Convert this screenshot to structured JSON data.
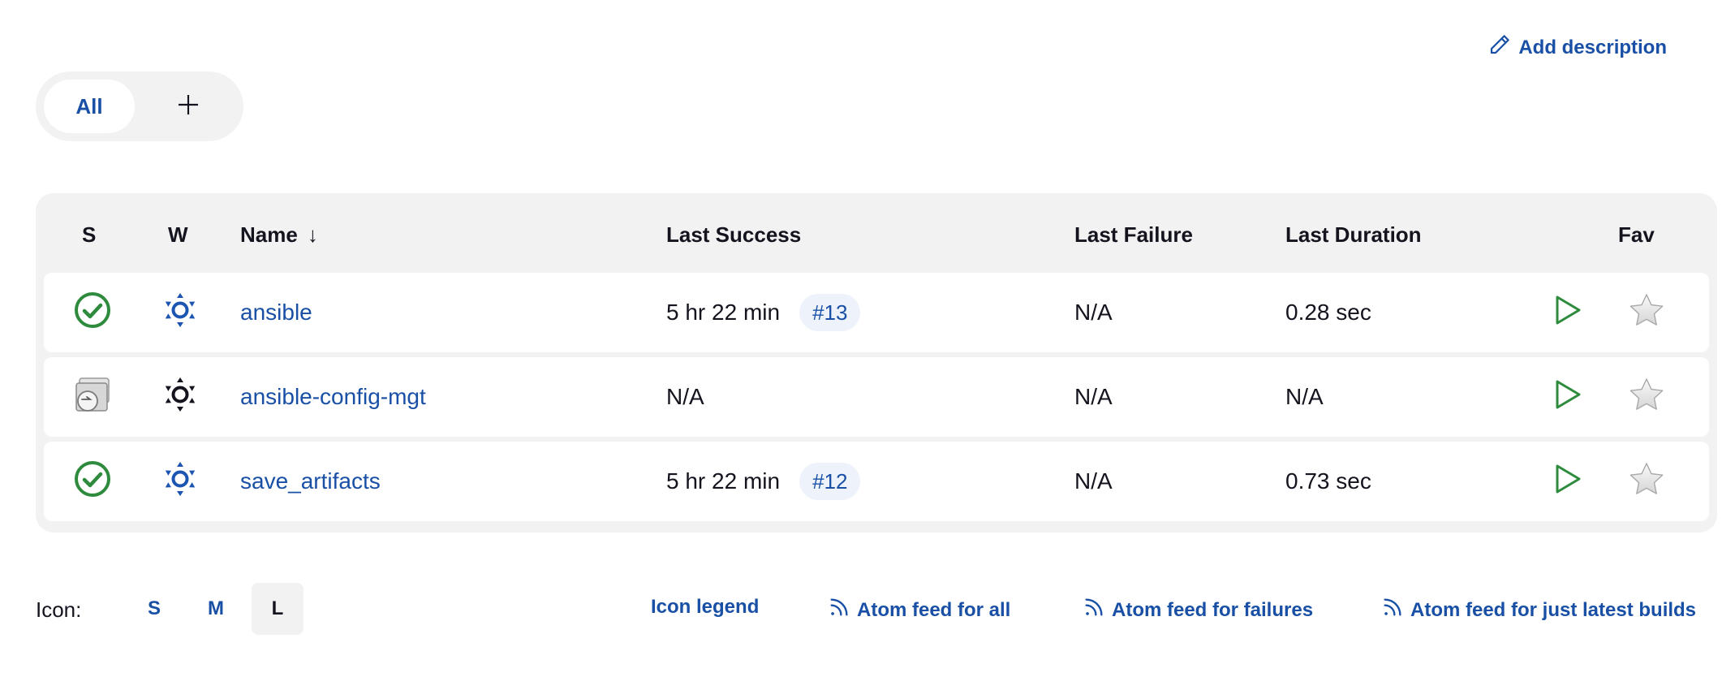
{
  "header": {
    "add_description": "Add description"
  },
  "tabs": {
    "all_label": "All"
  },
  "table": {
    "columns": {
      "status": "S",
      "weather": "W",
      "name": "Name",
      "sort_indicator": "↓",
      "last_success": "Last Success",
      "last_failure": "Last Failure",
      "last_duration": "Last Duration",
      "fav": "Fav"
    },
    "rows": [
      {
        "status": "success",
        "weather": "sunny",
        "name": "ansible",
        "last_success": "5 hr 22 min",
        "build": "#13",
        "last_failure": "N/A",
        "last_duration": "0.28 sec"
      },
      {
        "status": "not-built",
        "weather": "sunny",
        "name": "ansible-config-mgt",
        "last_success": "N/A",
        "build": "",
        "last_failure": "N/A",
        "last_duration": "N/A"
      },
      {
        "status": "success",
        "weather": "sunny",
        "name": "save_artifacts",
        "last_success": "5 hr 22 min",
        "build": "#12",
        "last_failure": "N/A",
        "last_duration": "0.73 sec"
      }
    ]
  },
  "footer": {
    "icon_label": "Icon:",
    "sizes": [
      "S",
      "M",
      "L"
    ],
    "selected_size": "L",
    "icon_legend": "Icon legend",
    "feed_all": "Atom feed for all",
    "feed_failures": "Atom feed for failures",
    "feed_latest": "Atom feed for just latest builds"
  },
  "colors": {
    "link": "#1950a6",
    "success": "#2e8b3e",
    "panel": "#f2f2f2",
    "weather_blue": "#1c54b2"
  },
  "icons": [
    "pencil-icon",
    "plus-icon",
    "success-icon",
    "not-built-icon",
    "weather-icon",
    "run-icon",
    "star-icon",
    "rss-icon"
  ]
}
